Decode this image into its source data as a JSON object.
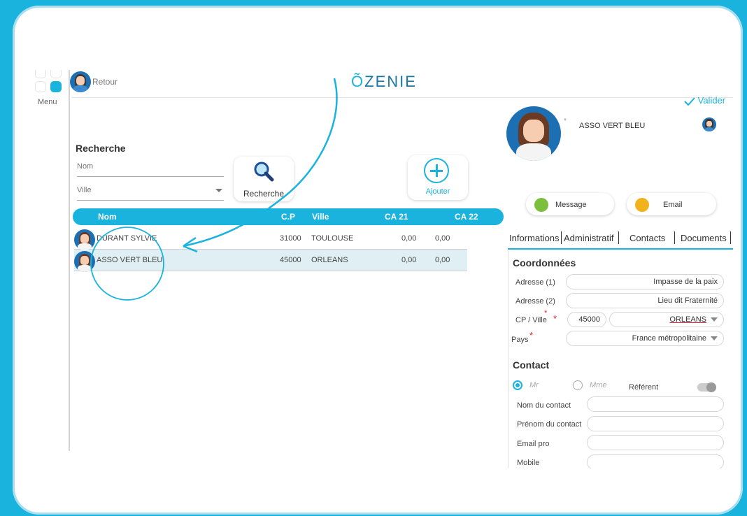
{
  "header": {
    "back_label": "Retour",
    "logo_text": "ZENIE",
    "logo_accent": "Õ"
  },
  "rail": {
    "menu_label": "Menu"
  },
  "search": {
    "title": "Recherche",
    "nom_placeholder": "Nom",
    "ville_placeholder": "Ville",
    "search_button_label": "Recherche",
    "add_button_label": "Ajouter"
  },
  "table": {
    "columns": [
      "Nom",
      "C.P",
      "Ville",
      "CA 21",
      "CA 22"
    ],
    "rows": [
      {
        "name": "DURANT SYLVIE",
        "cp": "31000",
        "ville": "TOULOUSE",
        "ca21": "0,00",
        "ca22": "0,00"
      },
      {
        "name": "ASSO VERT BLEU",
        "cp": "45000",
        "ville": "ORLEANS",
        "ca21": "0,00",
        "ca22": "0,00"
      }
    ]
  },
  "detail": {
    "valider_label": "Valider",
    "star": "*",
    "name": "ASSO VERT BLEU",
    "message_label": "Message",
    "email_label": "Email",
    "tabs": [
      "Informations",
      "Administratif",
      "Contacts",
      "Documents"
    ],
    "coordonnees_title": "Coordonnées",
    "adresse1_label": "Adresse (1)",
    "adresse1_value": "Impasse de la paix",
    "adresse2_label": "Adresse (2)",
    "adresse2_value": "Lieu dit Fraternité",
    "cpville_label": "CP / Ville",
    "cp_value": "45000",
    "ville_value": "ORLEANS",
    "pays_label": "Pays",
    "pays_value": "France métropolitaine",
    "req_mark": "*",
    "contact_title": "Contact",
    "mr_label": "Mr",
    "mme_label": "Mme",
    "referent_label": "Référent",
    "nom_contact_label": "Nom du contact",
    "prenom_contact_label": "Prénom du contact",
    "email_pro_label": "Email pro",
    "mobile_label": "Mobile"
  },
  "colors": {
    "accent": "#19b3de",
    "selected_row": "#e0eff4",
    "required": "#dd2222"
  }
}
